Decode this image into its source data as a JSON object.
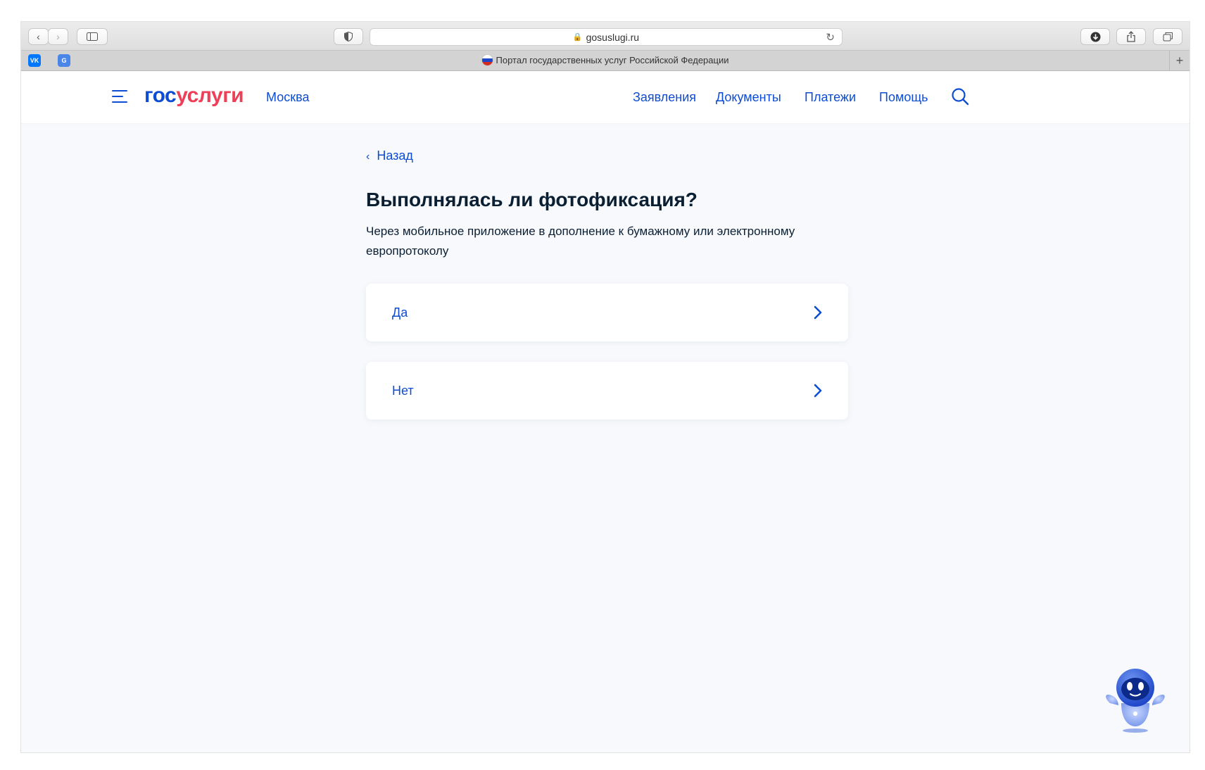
{
  "browser": {
    "url": "gosuslugi.ru",
    "tab_title": "Портал государственных услуг Российской Федерации",
    "bookmarks": [
      {
        "icon": "vk-icon",
        "label": "VK"
      },
      {
        "icon": "translate-icon",
        "label": "G"
      }
    ]
  },
  "header": {
    "logo_part1": "гос",
    "logo_part2": "услуги",
    "city": "Москва",
    "nav": [
      "Заявления",
      "Документы",
      "Платежи",
      "Помощь"
    ]
  },
  "content": {
    "back_label": "Назад",
    "title": "Выполнялась ли фотофиксация?",
    "subtitle": "Через мобильное приложение в дополнение к бумажному или электронному европротоколу",
    "options": [
      "Да",
      "Нет"
    ]
  },
  "colors": {
    "brand_blue": "#0d4cd3",
    "brand_red": "#ee3f58",
    "text_dark": "#0b1f33",
    "page_bg": "#f7f9fd"
  }
}
